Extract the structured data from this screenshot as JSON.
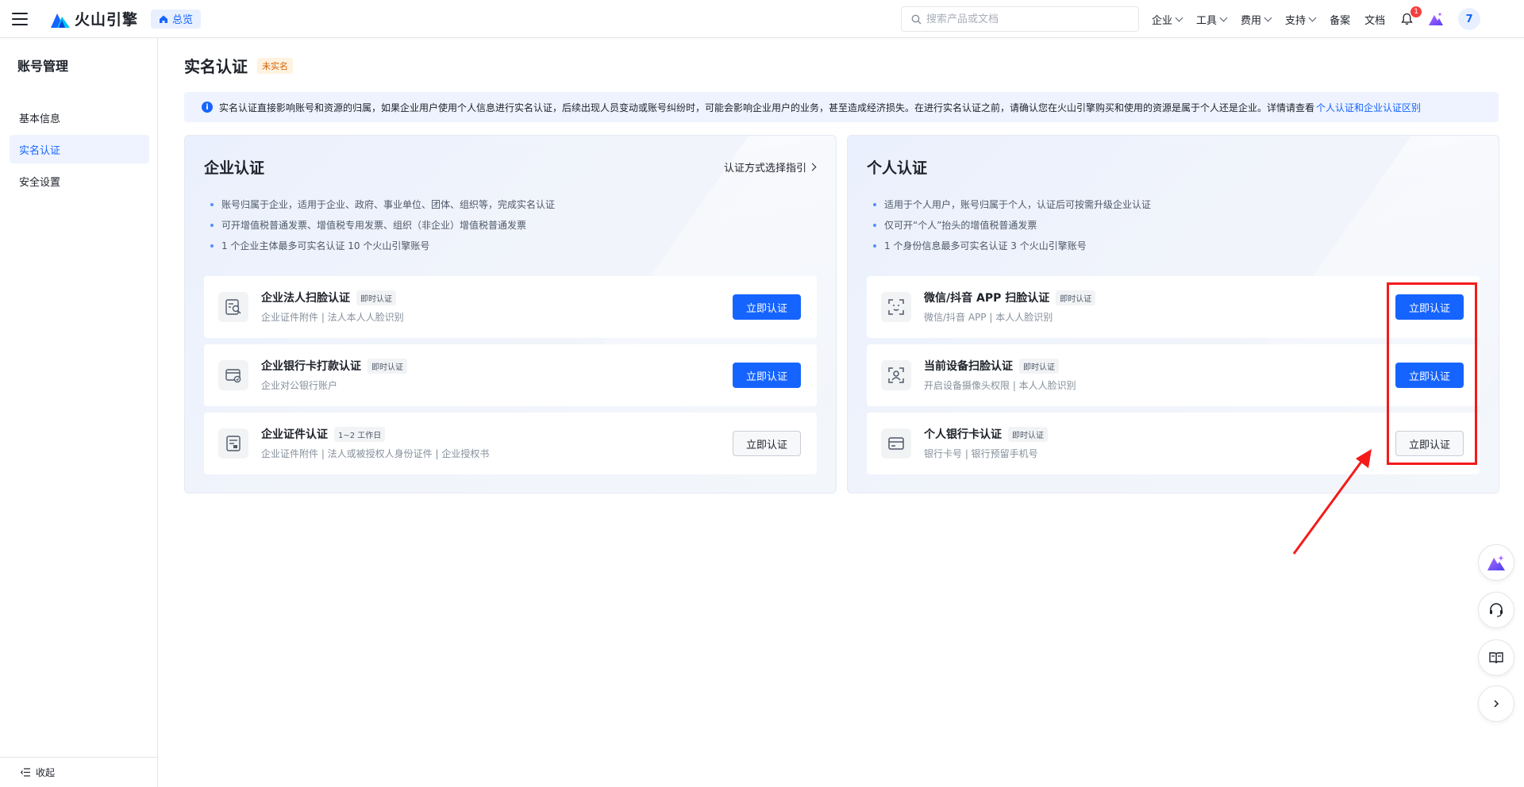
{
  "header": {
    "brand": "火山引擎",
    "home_chip": "总览",
    "search_placeholder": "搜索产品或文档",
    "nav": [
      {
        "label": "企业",
        "dropdown": true
      },
      {
        "label": "工具",
        "dropdown": true
      },
      {
        "label": "费用",
        "dropdown": true
      },
      {
        "label": "支持",
        "dropdown": true
      },
      {
        "label": "备案",
        "dropdown": false
      },
      {
        "label": "文档",
        "dropdown": false
      }
    ],
    "notification_count": "1",
    "avatar_initial": "7"
  },
  "sidebar": {
    "title": "账号管理",
    "items": [
      {
        "label": "基本信息",
        "active": false
      },
      {
        "label": "实名认证",
        "active": true
      },
      {
        "label": "安全设置",
        "active": false
      }
    ],
    "collapse_label": "收起"
  },
  "page": {
    "title": "实名认证",
    "status_tag": "未实名",
    "notice_text": "实名认证直接影响账号和资源的归属，如果企业用户使用个人信息进行实名认证，后续出现人员变动或账号纠纷时，可能会影响企业用户的业务，甚至造成经济损失。在进行实名认证之前，请确认您在火山引擎购买和使用的资源是属于个人还是企业。详情请查看",
    "notice_link": "个人认证和企业认证区别"
  },
  "enterprise": {
    "title": "企业认证",
    "guide_link": "认证方式选择指引",
    "bullets": [
      "账号归属于企业，适用于企业、政府、事业单位、团体、组织等，完成实名认证",
      "可开增值税普通发票、增值税专用发票、组织（非企业）增值税普通发票",
      "1 个企业主体最多可实名认证 10 个火山引擎账号"
    ],
    "cards": [
      {
        "title": "企业法人扫脸认证",
        "tag": "即时认证",
        "sub": "企业证件附件 | 法人本人人脸识别",
        "button": "立即认证",
        "primary": true,
        "icon": "face-scan-document-icon"
      },
      {
        "title": "企业银行卡打款认证",
        "tag": "即时认证",
        "sub": "企业对公银行账户",
        "button": "立即认证",
        "primary": true,
        "icon": "bank-card-transfer-icon"
      },
      {
        "title": "企业证件认证",
        "tag": "1~2 工作日",
        "sub": "企业证件附件 | 法人或被授权人身份证件 | 企业授权书",
        "button": "立即认证",
        "primary": false,
        "icon": "certificate-document-icon"
      }
    ]
  },
  "personal": {
    "title": "个人认证",
    "bullets": [
      "适用于个人用户，账号归属于个人，认证后可按需升级企业认证",
      "仅可开“个人”抬头的增值税普通发票",
      "1 个身份信息最多可实名认证 3 个火山引擎账号"
    ],
    "cards": [
      {
        "title": "微信/抖音 APP 扫脸认证",
        "tag": "即时认证",
        "sub": "微信/抖音 APP | 本人人脸识别",
        "button": "立即认证",
        "primary": true,
        "icon": "scan-qr-icon"
      },
      {
        "title": "当前设备扫脸认证",
        "tag": "即时认证",
        "sub": "开启设备摄像头权限 | 本人人脸识别",
        "button": "立即认证",
        "primary": true,
        "icon": "face-scan-icon"
      },
      {
        "title": "个人银行卡认证",
        "tag": "即时认证",
        "sub": "银行卡号 | 银行预留手机号",
        "button": "立即认证",
        "primary": false,
        "icon": "bank-card-icon"
      }
    ]
  },
  "float_tools": [
    "ai-assistant-icon",
    "customer-service-icon",
    "docs-book-icon",
    "expand-chevron-icon"
  ],
  "colors": {
    "primary": "#1664ff",
    "annotation": "#f51a1a",
    "status_tag": "#d25f00"
  }
}
